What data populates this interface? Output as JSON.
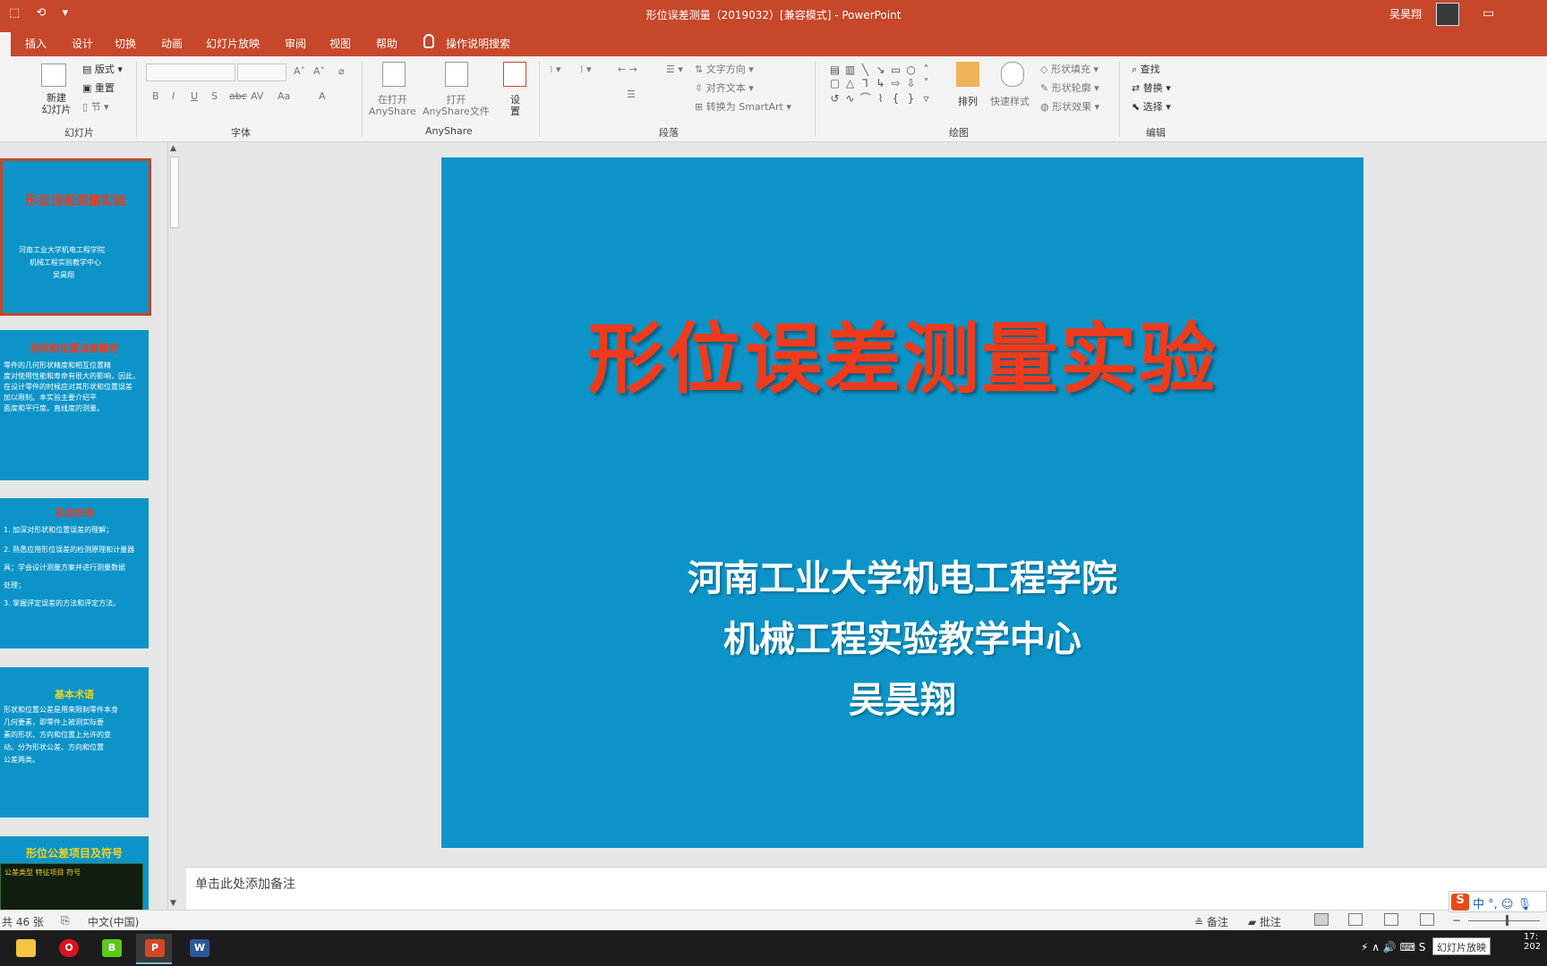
{
  "titlebar": {
    "qat": [
      "⬚",
      "⟲",
      "▾"
    ],
    "doc_title": "形位误差测量（2019032）[兼容模式] - PowerPoint",
    "user": "吴昊翔",
    "ribbon_options_icon": "ribbon-display-icon",
    "accent": "#c7472a"
  },
  "tabs": [
    "插入",
    "设计",
    "切换",
    "动画",
    "幻灯片放映",
    "审阅",
    "视图",
    "帮助",
    "操作说明搜索"
  ],
  "ribbon": {
    "slides_group": {
      "new_slide": "新建\n幻灯片",
      "layout": "版式",
      "reset": "重置",
      "section": "节",
      "label": "幻灯片"
    },
    "font_group": {
      "label": "字体",
      "buttons": [
        "B",
        "I",
        "U",
        "S",
        "abc",
        "AV",
        "Aa",
        "A"
      ]
    },
    "anyshare_group": {
      "open": "在打开\nAnyShare",
      "open_file": "打开\nAnyShare文件",
      "settings": "设\n置",
      "label": "AnyShare"
    },
    "paragraph_group": {
      "text_dir": "文字方向",
      "align_text": "对齐文本",
      "smartart": "转换为 SmartArt",
      "label": "段落"
    },
    "drawing_group": {
      "arrange": "排列",
      "quick_styles": "快速样式",
      "fill": "形状填充",
      "outline": "形状轮廓",
      "effects": "形状效果",
      "label": "绘图"
    },
    "editing_group": {
      "find": "查找",
      "replace": "替换",
      "select": "选择",
      "label": "编辑"
    }
  },
  "thumbnails": [
    {
      "title": "形位误差测量实验",
      "title_color": "#ee3b1c",
      "lines": [
        "河南工业大学机电工程学院",
        "机械工程实验教学中心",
        "吴昊翔"
      ]
    },
    {
      "title": "形状和位置误差概述",
      "title_color": "#ee3b1c",
      "lines": [
        "零件的几何形状精度和相互位置精",
        "度对使用性能和寿命有很大的影响，因此，",
        "在设计零件的时候应对其形状和位置误差",
        "加以限制。本实验主要介绍平",
        "面度和平行度。直线度的测量。"
      ]
    },
    {
      "title": "实验目的",
      "title_color": "#ee3b1c",
      "lines": [
        "1. 加深对形状和位置误差的理解；",
        "2. 熟悉应用形位误差的检测原理和计量器",
        "具；学会设计测量方案并进行测量数据",
        "处理；",
        "3. 掌握评定误差的方法和评定方法。"
      ]
    },
    {
      "title": "基本术语",
      "title_color": "#f2d21b",
      "lines": [
        "形状和位置公差是用来限制零件本身",
        "几何要素，即零件上被测实际要",
        "素的形状、方向和位置上允许的变",
        "动。分为形状公差、方向和位置",
        "公差两类。"
      ]
    },
    {
      "title": "形位公差项目及符号",
      "title_color": "#f2d21b",
      "lines": [
        "公差类型 特征项目 符号"
      ]
    }
  ],
  "slide": {
    "title": "形位误差测量实验",
    "lines": [
      "河南工业大学机电工程学院",
      "机械工程实验教学中心",
      "吴昊翔"
    ],
    "background": "#0c94c8",
    "title_color": "#ee3b1c"
  },
  "notes_placeholder": "单击此处添加备注",
  "status": {
    "slide_count": "共 46 张",
    "language": "中文(中国)",
    "notes": "备注",
    "comments": "批注",
    "tooltip": "幻灯片放映"
  },
  "ime": {
    "logo": "S",
    "mode": "中 °, ☺ 🎙"
  },
  "taskbar": {
    "apps": [
      "file-explorer-icon",
      "opera-icon",
      "bilibili-icon",
      "powerpoint-icon",
      "word-icon"
    ],
    "tray": "⚡ ∧ 🔊 ⌨ S",
    "clock": "17:\n202"
  }
}
